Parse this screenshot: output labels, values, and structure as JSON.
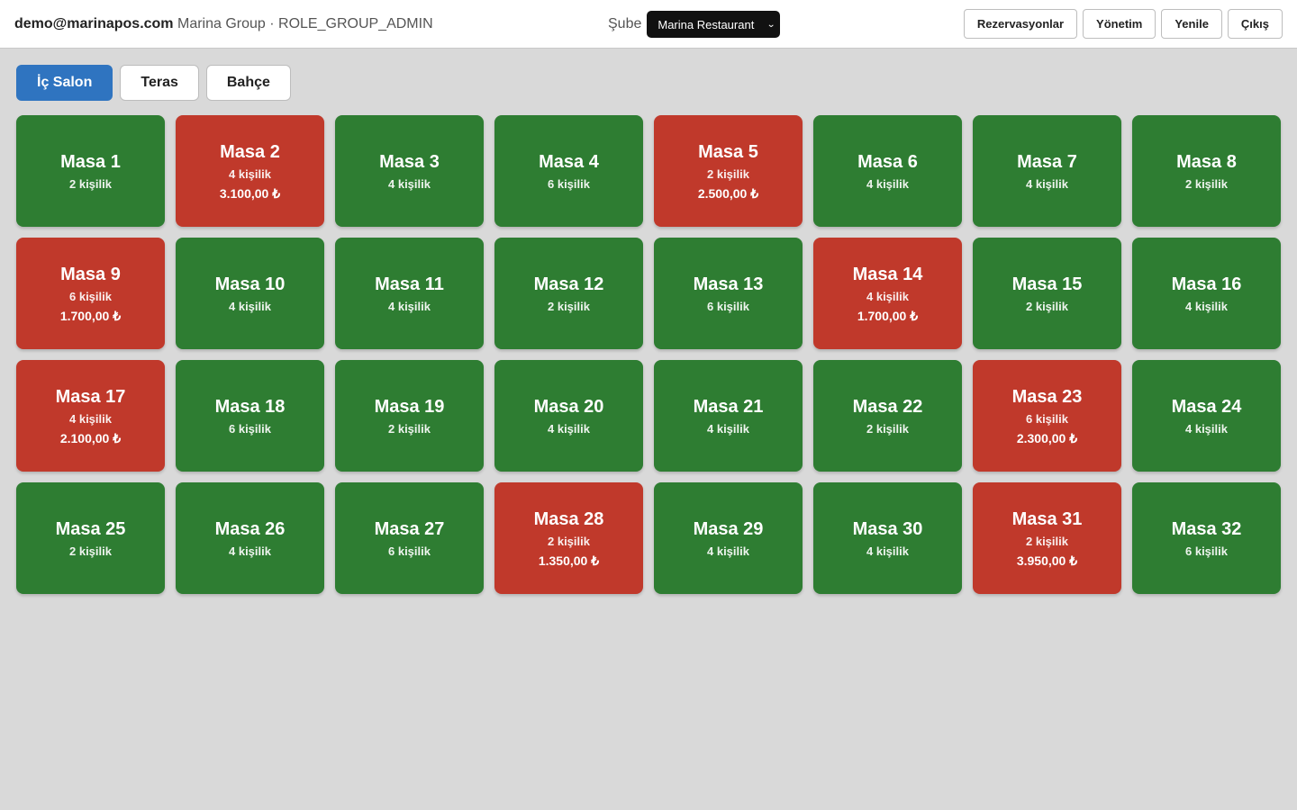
{
  "header": {
    "user_email": "demo@marinapos.com",
    "user_group": "Marina Group · ROLE_GROUP_ADMIN",
    "branch_label": "Şube",
    "branch_selected": "Marina Restaurant",
    "actions": {
      "reservations": "Rezervasyonlar",
      "management": "Yönetim",
      "refresh": "Yenile",
      "logout": "Çıkış"
    }
  },
  "tabs": [
    {
      "label": "İç Salon",
      "active": true
    },
    {
      "label": "Teras",
      "active": false
    },
    {
      "label": "Bahçe",
      "active": false
    }
  ],
  "colors": {
    "free": "#2e7d32",
    "occupied": "#c0392b",
    "active_tab": "#2f74c0"
  },
  "tables": [
    {
      "name": "Masa 1",
      "capacity": "2 kişilik",
      "status": "free",
      "total": ""
    },
    {
      "name": "Masa 2",
      "capacity": "4 kişilik",
      "status": "occupied",
      "total": "3.100,00 ₺"
    },
    {
      "name": "Masa 3",
      "capacity": "4 kişilik",
      "status": "free",
      "total": ""
    },
    {
      "name": "Masa 4",
      "capacity": "6 kişilik",
      "status": "free",
      "total": ""
    },
    {
      "name": "Masa 5",
      "capacity": "2 kişilik",
      "status": "occupied",
      "total": "2.500,00 ₺"
    },
    {
      "name": "Masa 6",
      "capacity": "4 kişilik",
      "status": "free",
      "total": ""
    },
    {
      "name": "Masa 7",
      "capacity": "4 kişilik",
      "status": "free",
      "total": ""
    },
    {
      "name": "Masa 8",
      "capacity": "2 kişilik",
      "status": "free",
      "total": ""
    },
    {
      "name": "Masa 9",
      "capacity": "6 kişilik",
      "status": "occupied",
      "total": "1.700,00 ₺"
    },
    {
      "name": "Masa 10",
      "capacity": "4 kişilik",
      "status": "free",
      "total": ""
    },
    {
      "name": "Masa 11",
      "capacity": "4 kişilik",
      "status": "free",
      "total": ""
    },
    {
      "name": "Masa 12",
      "capacity": "2 kişilik",
      "status": "free",
      "total": ""
    },
    {
      "name": "Masa 13",
      "capacity": "6 kişilik",
      "status": "free",
      "total": ""
    },
    {
      "name": "Masa 14",
      "capacity": "4 kişilik",
      "status": "occupied",
      "total": "1.700,00 ₺"
    },
    {
      "name": "Masa 15",
      "capacity": "2 kişilik",
      "status": "free",
      "total": ""
    },
    {
      "name": "Masa 16",
      "capacity": "4 kişilik",
      "status": "free",
      "total": ""
    },
    {
      "name": "Masa 17",
      "capacity": "4 kişilik",
      "status": "occupied",
      "total": "2.100,00 ₺"
    },
    {
      "name": "Masa 18",
      "capacity": "6 kişilik",
      "status": "free",
      "total": ""
    },
    {
      "name": "Masa 19",
      "capacity": "2 kişilik",
      "status": "free",
      "total": ""
    },
    {
      "name": "Masa 20",
      "capacity": "4 kişilik",
      "status": "free",
      "total": ""
    },
    {
      "name": "Masa 21",
      "capacity": "4 kişilik",
      "status": "free",
      "total": ""
    },
    {
      "name": "Masa 22",
      "capacity": "2 kişilik",
      "status": "free",
      "total": ""
    },
    {
      "name": "Masa 23",
      "capacity": "6 kişilik",
      "status": "occupied",
      "total": "2.300,00 ₺"
    },
    {
      "name": "Masa 24",
      "capacity": "4 kişilik",
      "status": "free",
      "total": ""
    },
    {
      "name": "Masa 25",
      "capacity": "2 kişilik",
      "status": "free",
      "total": ""
    },
    {
      "name": "Masa 26",
      "capacity": "4 kişilik",
      "status": "free",
      "total": ""
    },
    {
      "name": "Masa 27",
      "capacity": "6 kişilik",
      "status": "free",
      "total": ""
    },
    {
      "name": "Masa 28",
      "capacity": "2 kişilik",
      "status": "occupied",
      "total": "1.350,00 ₺"
    },
    {
      "name": "Masa 29",
      "capacity": "4 kişilik",
      "status": "free",
      "total": ""
    },
    {
      "name": "Masa 30",
      "capacity": "4 kişilik",
      "status": "free",
      "total": ""
    },
    {
      "name": "Masa 31",
      "capacity": "2 kişilik",
      "status": "occupied",
      "total": "3.950,00 ₺"
    },
    {
      "name": "Masa 32",
      "capacity": "6 kişilik",
      "status": "free",
      "total": ""
    }
  ]
}
